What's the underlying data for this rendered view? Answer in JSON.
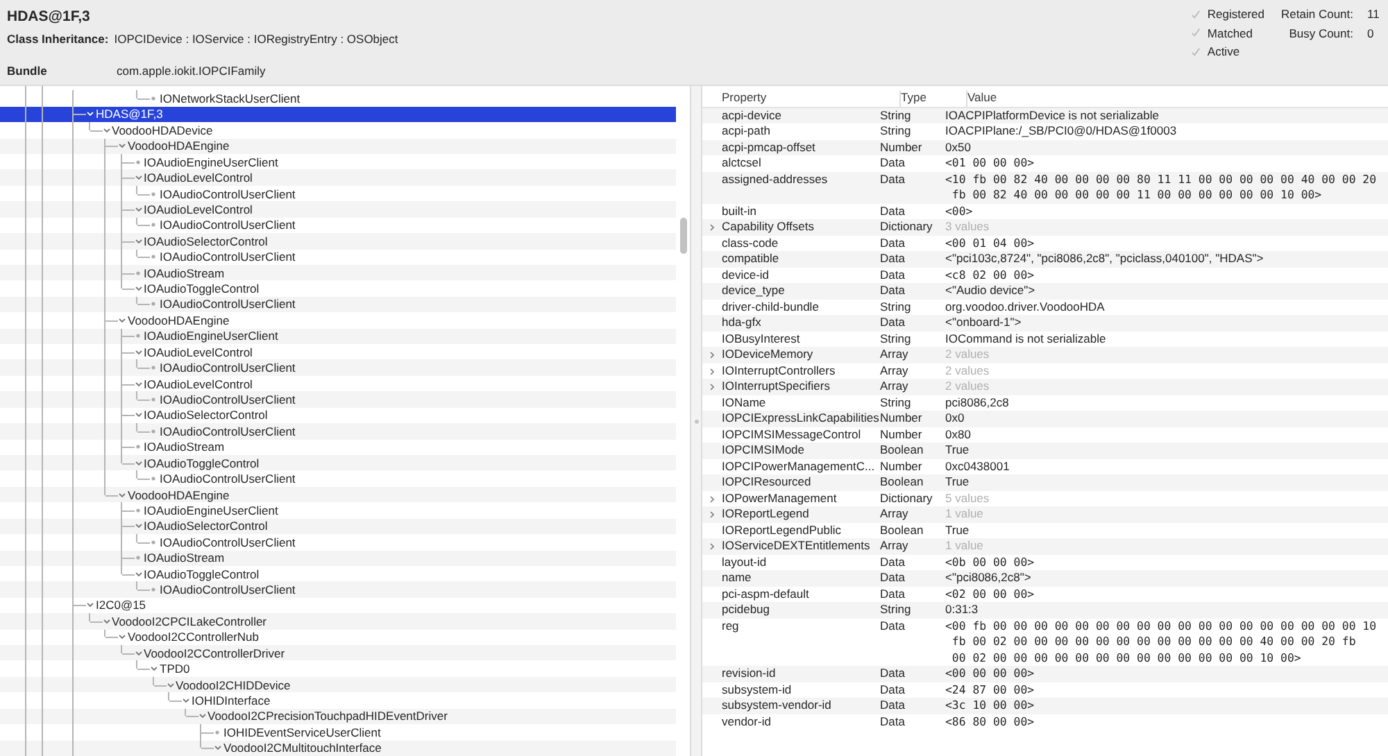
{
  "header": {
    "title": "HDAS@1F,3",
    "inheritance_label": "Class Inheritance:",
    "inheritance": "IOPCIDevice : IOService : IORegistryEntry : OSObject",
    "bundle_label": "Bundle",
    "bundle": "com.apple.iokit.IOPCIFamily",
    "flags": [
      {
        "label": "Registered",
        "checked": true
      },
      {
        "label": "Matched",
        "checked": true
      },
      {
        "label": "Active",
        "checked": true
      }
    ],
    "counts": [
      {
        "label": "Retain Count:",
        "value": "11"
      },
      {
        "label": "Busy Count:",
        "value": "0"
      }
    ]
  },
  "tree": [
    {
      "name": "IONetworkStackUserClient",
      "kind": "continued",
      "selected": false
    },
    {
      "name": "HDAS@1F,3",
      "selected": true,
      "expanded": true,
      "children": [
        {
          "name": "VoodooHDADevice",
          "selected": false,
          "expanded": true,
          "children": [
            {
              "name": "VoodooHDAEngine",
              "selected": false,
              "expanded": true,
              "children": [
                {
                  "name": "IOAudioEngineUserClient",
                  "selected": false
                },
                {
                  "name": "IOAudioLevelControl",
                  "selected": false,
                  "expanded": true,
                  "children": [
                    {
                      "name": "IOAudioControlUserClient",
                      "selected": false
                    }
                  ]
                },
                {
                  "name": "IOAudioLevelControl",
                  "selected": false,
                  "expanded": true,
                  "children": [
                    {
                      "name": "IOAudioControlUserClient",
                      "selected": false
                    }
                  ]
                },
                {
                  "name": "IOAudioSelectorControl",
                  "selected": false,
                  "expanded": true,
                  "children": [
                    {
                      "name": "IOAudioControlUserClient",
                      "selected": false
                    }
                  ]
                },
                {
                  "name": "IOAudioStream",
                  "selected": false
                },
                {
                  "name": "IOAudioToggleControl",
                  "selected": false,
                  "expanded": true,
                  "children": [
                    {
                      "name": "IOAudioControlUserClient",
                      "selected": false
                    }
                  ]
                }
              ]
            },
            {
              "name": "VoodooHDAEngine",
              "selected": false,
              "expanded": true,
              "children": [
                {
                  "name": "IOAudioEngineUserClient",
                  "selected": false
                },
                {
                  "name": "IOAudioLevelControl",
                  "selected": false,
                  "expanded": true,
                  "children": [
                    {
                      "name": "IOAudioControlUserClient",
                      "selected": false
                    }
                  ]
                },
                {
                  "name": "IOAudioLevelControl",
                  "selected": false,
                  "expanded": true,
                  "children": [
                    {
                      "name": "IOAudioControlUserClient",
                      "selected": false
                    }
                  ]
                },
                {
                  "name": "IOAudioSelectorControl",
                  "selected": false,
                  "expanded": true,
                  "children": [
                    {
                      "name": "IOAudioControlUserClient",
                      "selected": false
                    }
                  ]
                },
                {
                  "name": "IOAudioStream",
                  "selected": false
                },
                {
                  "name": "IOAudioToggleControl",
                  "selected": false,
                  "expanded": true,
                  "children": [
                    {
                      "name": "IOAudioControlUserClient",
                      "selected": false
                    }
                  ]
                }
              ]
            },
            {
              "name": "VoodooHDAEngine",
              "selected": false,
              "expanded": true,
              "children": [
                {
                  "name": "IOAudioEngineUserClient",
                  "selected": false
                },
                {
                  "name": "IOAudioSelectorControl",
                  "selected": false,
                  "expanded": true,
                  "children": [
                    {
                      "name": "IOAudioControlUserClient",
                      "selected": false
                    }
                  ]
                },
                {
                  "name": "IOAudioStream",
                  "selected": false
                },
                {
                  "name": "IOAudioToggleControl",
                  "selected": false,
                  "expanded": true,
                  "children": [
                    {
                      "name": "IOAudioControlUserClient",
                      "selected": false
                    }
                  ]
                }
              ]
            }
          ]
        }
      ]
    },
    {
      "name": "I2C0@15",
      "selected": false,
      "expanded": true,
      "children": [
        {
          "name": "VoodooI2CPCILakeController",
          "selected": false,
          "expanded": true,
          "children": [
            {
              "name": "VoodooI2CControllerNub",
              "selected": false,
              "expanded": true,
              "children": [
                {
                  "name": "VoodooI2CControllerDriver",
                  "selected": false,
                  "expanded": true,
                  "children": [
                    {
                      "name": "TPD0",
                      "selected": false,
                      "expanded": true,
                      "children": [
                        {
                          "name": "VoodooI2CHIDDevice",
                          "selected": false,
                          "expanded": true,
                          "children": [
                            {
                              "name": "IOHIDInterface",
                              "selected": false,
                              "expanded": true,
                              "children": [
                                {
                                  "name": "VoodooI2CPrecisionTouchpadHIDEventDriver",
                                  "selected": false,
                                  "expanded": true,
                                  "children": [
                                    {
                                      "name": "IOHIDEventServiceUserClient",
                                      "selected": false
                                    },
                                    {
                                      "name": "VoodooI2CMultitouchInterface",
                                      "selected": false,
                                      "expanded": true
                                    }
                                  ]
                                }
                              ]
                            }
                          ]
                        }
                      ]
                    }
                  ]
                }
              ]
            }
          ]
        }
      ]
    }
  ],
  "properties": {
    "columns": [
      "Property",
      "Type",
      "Value"
    ],
    "rows": [
      {
        "property": "acpi-device",
        "type": "String",
        "kind": "text",
        "value": [
          "IOACPIPlatformDevice is not serializable"
        ]
      },
      {
        "property": "acpi-path",
        "type": "String",
        "kind": "text",
        "value": [
          "IOACPIPlane:/_SB/PCI0@0/HDAS@1f0003"
        ]
      },
      {
        "property": "acpi-pmcap-offset",
        "type": "Number",
        "kind": "text",
        "value": [
          "0x50"
        ]
      },
      {
        "property": "alctcsel",
        "type": "Data",
        "kind": "data",
        "value": [
          "<01 00 00 00>"
        ]
      },
      {
        "property": "assigned-addresses",
        "type": "Data",
        "kind": "data",
        "value": [
          "<10 fb 00 82 40 00 00 00 00 80 11 11 00 00 00 00 00 40 00 00 20",
          " fb 00 82 40 00 00 00 00 00 11 00 00 00 00 00 00 10 00>"
        ]
      },
      {
        "property": "built-in",
        "type": "Data",
        "kind": "data",
        "value": [
          "<00>"
        ]
      },
      {
        "property": "Capability Offsets",
        "type": "Dictionary",
        "kind": "summary",
        "expanded": false,
        "value": [
          "3 values"
        ]
      },
      {
        "property": "class-code",
        "type": "Data",
        "kind": "data",
        "value": [
          "<00 01 04 00>"
        ]
      },
      {
        "property": "compatible",
        "type": "Data",
        "kind": "text",
        "value": [
          "<\"pci103c,8724\", \"pci8086,2c8\", \"pciclass,040100\", \"HDAS\">"
        ]
      },
      {
        "property": "device-id",
        "type": "Data",
        "kind": "data",
        "value": [
          "<c8 02 00 00>"
        ]
      },
      {
        "property": "device_type",
        "type": "Data",
        "kind": "text",
        "value": [
          "<\"Audio device\">"
        ]
      },
      {
        "property": "driver-child-bundle",
        "type": "String",
        "kind": "text",
        "value": [
          "org.voodoo.driver.VoodooHDA"
        ]
      },
      {
        "property": "hda-gfx",
        "type": "Data",
        "kind": "text",
        "value": [
          "<\"onboard-1\">"
        ]
      },
      {
        "property": "IOBusyInterest",
        "type": "String",
        "kind": "text",
        "value": [
          "IOCommand is not serializable"
        ]
      },
      {
        "property": "IODeviceMemory",
        "type": "Array",
        "kind": "summary",
        "expanded": false,
        "value": [
          "2 values"
        ]
      },
      {
        "property": "IOInterruptControllers",
        "type": "Array",
        "kind": "summary",
        "expanded": false,
        "value": [
          "2 values"
        ]
      },
      {
        "property": "IOInterruptSpecifiers",
        "type": "Array",
        "kind": "summary",
        "expanded": false,
        "value": [
          "2 values"
        ]
      },
      {
        "property": "IOName",
        "type": "String",
        "kind": "text",
        "value": [
          "pci8086,2c8"
        ]
      },
      {
        "property": "IOPCIExpressLinkCapabilities",
        "type": "Number",
        "kind": "text",
        "value": [
          "0x0"
        ]
      },
      {
        "property": "IOPCIMSIMessageControl",
        "type": "Number",
        "kind": "text",
        "value": [
          "0x80"
        ]
      },
      {
        "property": "IOPCIMSIMode",
        "type": "Boolean",
        "kind": "text",
        "value": [
          "True"
        ]
      },
      {
        "property": "IOPCIPowerManagementC...",
        "type": "Number",
        "kind": "text",
        "value": [
          "0xc0438001"
        ]
      },
      {
        "property": "IOPCIResourced",
        "type": "Boolean",
        "kind": "text",
        "value": [
          "True"
        ]
      },
      {
        "property": "IOPowerManagement",
        "type": "Dictionary",
        "kind": "summary",
        "expanded": false,
        "value": [
          "5 values"
        ]
      },
      {
        "property": "IOReportLegend",
        "type": "Array",
        "kind": "summary",
        "expanded": false,
        "value": [
          "1 value"
        ]
      },
      {
        "property": "IOReportLegendPublic",
        "type": "Boolean",
        "kind": "text",
        "value": [
          "True"
        ]
      },
      {
        "property": "IOServiceDEXTEntitlements",
        "type": "Array",
        "kind": "summary",
        "expanded": false,
        "value": [
          "1 value"
        ]
      },
      {
        "property": "layout-id",
        "type": "Data",
        "kind": "data",
        "value": [
          "<0b 00 00 00>"
        ]
      },
      {
        "property": "name",
        "type": "Data",
        "kind": "text",
        "value": [
          "<\"pci8086,2c8\">"
        ]
      },
      {
        "property": "pci-aspm-default",
        "type": "Data",
        "kind": "data",
        "value": [
          "<02 00 00 00>"
        ]
      },
      {
        "property": "pcidebug",
        "type": "String",
        "kind": "text",
        "value": [
          "0:31:3"
        ]
      },
      {
        "property": "reg",
        "type": "Data",
        "kind": "data",
        "value": [
          "<00 fb 00 00 00 00 00 00 00 00 00 00 00 00 00 00 00 00 00 00 10",
          " fb 00 02 00 00 00 00 00 00 00 00 00 00 00 00 40 00 00 20 fb",
          " 00 02 00 00 00 00 00 00 00 00 00 00 00 00 00 10 00>"
        ]
      },
      {
        "property": "revision-id",
        "type": "Data",
        "kind": "data",
        "value": [
          "<00 00 00 00>"
        ]
      },
      {
        "property": "subsystem-id",
        "type": "Data",
        "kind": "data",
        "value": [
          "<24 87 00 00>"
        ]
      },
      {
        "property": "subsystem-vendor-id",
        "type": "Data",
        "kind": "data",
        "value": [
          "<3c 10 00 00>"
        ]
      },
      {
        "property": "vendor-id",
        "type": "Data",
        "kind": "data",
        "value": [
          "<86 80 00 00>"
        ]
      }
    ]
  }
}
